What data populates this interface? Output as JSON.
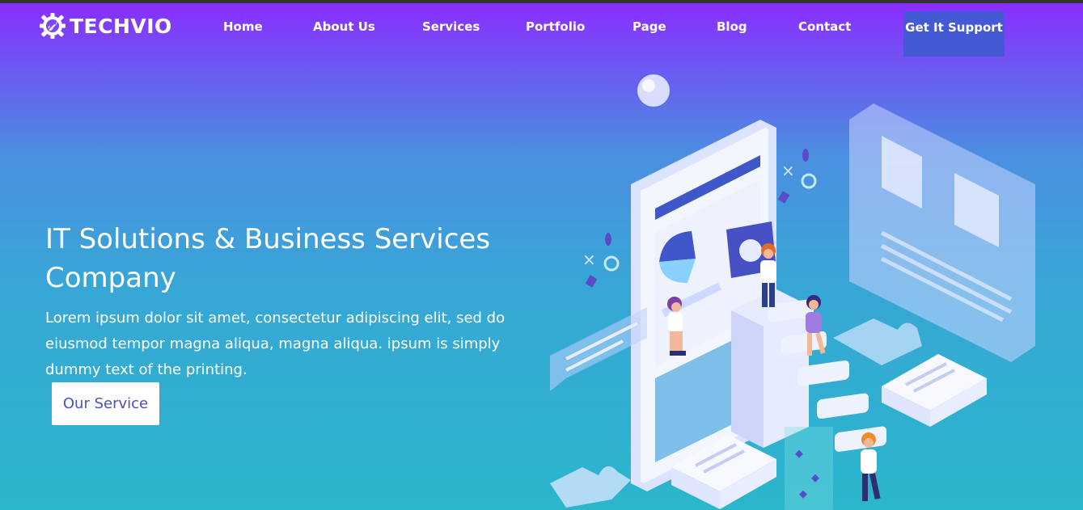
{
  "brand": {
    "name": "TECHVIO",
    "logo_icon": "gear-rocket-icon"
  },
  "nav": {
    "items": [
      {
        "label": "Home"
      },
      {
        "label": "About Us"
      },
      {
        "label": "Services"
      },
      {
        "label": "Portfolio"
      },
      {
        "label": "Page"
      },
      {
        "label": "Blog"
      },
      {
        "label": "Contact"
      }
    ],
    "cta_label": "Get It Support"
  },
  "hero": {
    "headline": "IT Solutions & Business Services Company",
    "description": "Lorem ipsum dolor sit amet, consectetur adipiscing elit, sed do eiusmod tempor magna aliqua, magna aliqua. ipsum is simply dummy text of the printing.",
    "button_label": "Our Service"
  },
  "colors": {
    "gradient_top": "#8a2eff",
    "gradient_bottom": "#2ab6cc",
    "cta_background": "#4459d4",
    "button_text": "#4a4fc0"
  }
}
